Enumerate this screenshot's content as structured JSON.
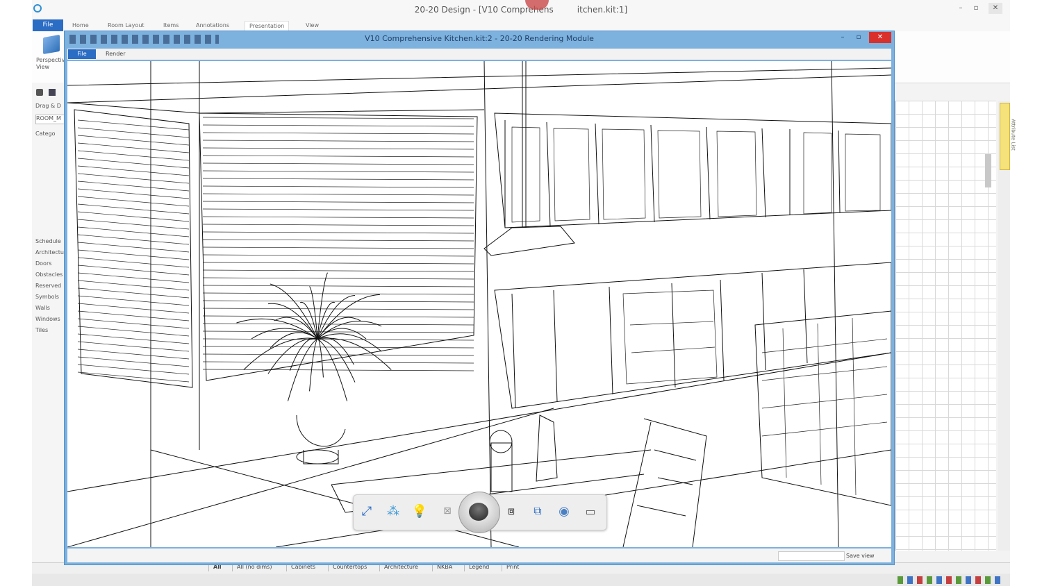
{
  "app": {
    "title": "20-20 Design - [V10 Comprehensive Kitchen.kit:1]",
    "title_visible": "20-20 Design - [V10 Comprehens",
    "title_visible_tail": "itchen.kit:1]",
    "ribbon_tabs": [
      "Home",
      "Room Layout",
      "Items",
      "Annotations",
      "Presentation",
      "View"
    ],
    "file_tab": "File",
    "perspective_label": "Perspective View",
    "side_labels": [
      "Drag & D",
      "ROOM_M",
      "Catego"
    ],
    "side_list": [
      "Schedule",
      "Architectu",
      "Doors",
      "Obstacles",
      "Reserved",
      "Symbols",
      "Walls",
      "Windows",
      "Tiles"
    ],
    "right_tab": "Attribute List",
    "bottom_tabs": [
      "All",
      "All (no dims)",
      "Cabinets",
      "Countertops",
      "Architecture",
      "NKBA",
      "Legend",
      "Print"
    ]
  },
  "render": {
    "title": "V10 Comprehensive Kitchen.kit:2 - 20-20 Rendering Module",
    "tabs": [
      "File",
      "Render"
    ],
    "save_view": "Save view"
  },
  "nav_toolbar": {
    "buttons": [
      "fit-view-icon",
      "walk-icon",
      "light-bulb-icon",
      "zoom-icon",
      "orbit-control",
      "zoom-extents-icon",
      "camera-view-icon",
      "rotate-icon",
      "render-mode-icon"
    ]
  },
  "colors": {
    "title_accent": "#2b6cc4",
    "render_frame": "#7db1de"
  }
}
